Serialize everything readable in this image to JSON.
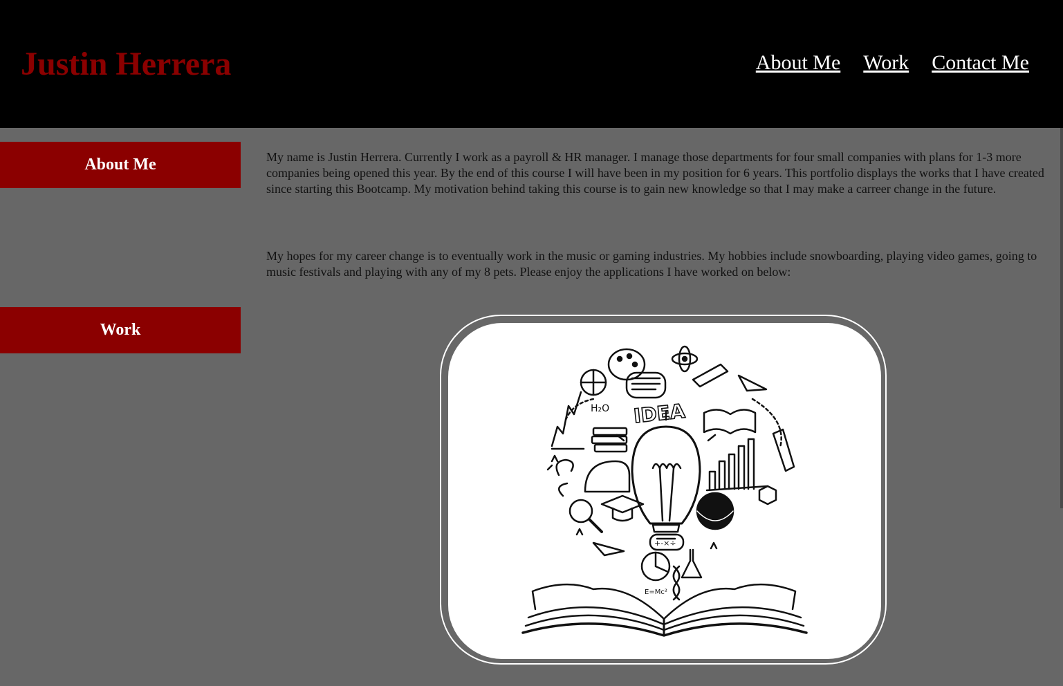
{
  "header": {
    "title": "Justin Herrera",
    "nav": [
      "About Me",
      "Work",
      "Contact Me"
    ]
  },
  "sections": {
    "about_label": "About Me",
    "work_label": "Work"
  },
  "about": {
    "paragraph1": "My name is Justin Herrera. Currently I work as a payroll & HR manager. I manage those departments for four small companies with plans for 1-3 more companies being opened this year. By the end of this course I will have been in my position for 6 years. This portfolio displays the works that I have created since starting this Bootcamp. My motivation behind taking this course is to gain new knowledge so that I may make a carreer change in the future.",
    "paragraph2": "My hopes for my career change is to eventually work in the music or gaming industries. My hobbies include snowboarding, playing video games, going to music festivals and playing with any of my 8 pets. Please enjoy the applications I have worked on below:"
  },
  "work": {
    "image_text": "IDEA",
    "image_formula": "E=Mc²",
    "image_water": "H₂O",
    "image_ops": "+-×÷"
  },
  "colors": {
    "accent": "#8b0000",
    "header_bg": "#000000",
    "page_bg": "#676767"
  }
}
